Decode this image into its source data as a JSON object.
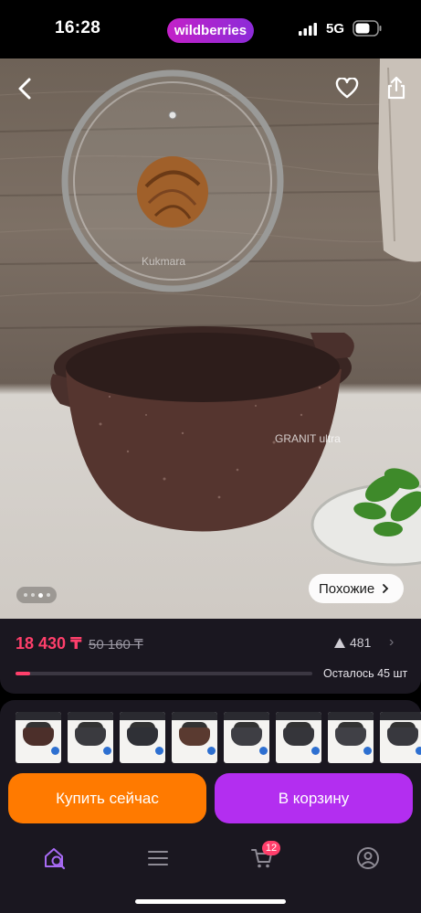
{
  "status_bar": {
    "time": "16:28",
    "brand": "wildberries",
    "network": "5G"
  },
  "photo": {
    "lid_brand": "Kukmara",
    "pot_label": "GRANIT ultra",
    "similar_label": "Похожие",
    "slide_count": 4,
    "active_slide": 3
  },
  "pricing": {
    "price": "18 430 ₸",
    "old_price": "50 160 ₸",
    "rating_count": "481",
    "stock_progress": 0.05,
    "stock_label": "Осталось 45 шт"
  },
  "actions": {
    "buy_now": "Купить сейчас",
    "add_to_cart": "В корзину"
  },
  "bottom_nav": {
    "cart_count": "12"
  },
  "colors": {
    "brand": "#b32ef0",
    "accent_price": "#ff3f6b",
    "buy_now": "#ff7a00",
    "background": "#1a1720"
  }
}
